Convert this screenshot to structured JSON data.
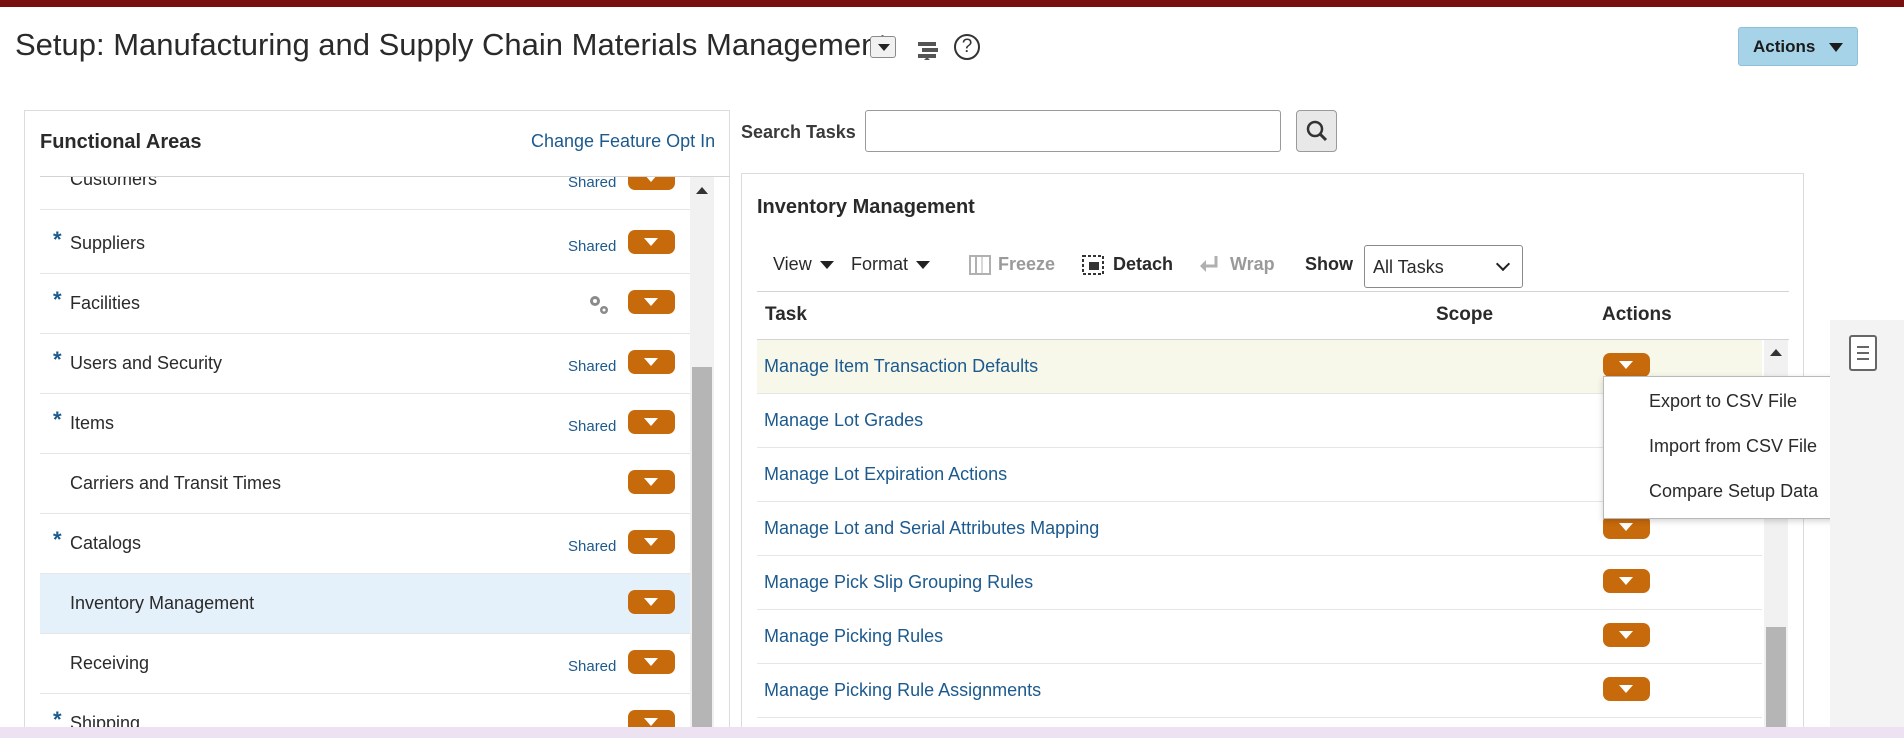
{
  "header": {
    "title": "Setup: Manufacturing and Supply Chain Materials Management",
    "help_glyph": "?",
    "actions_label": "Actions"
  },
  "functional_areas": {
    "title": "Functional Areas",
    "change_link": "Change Feature Opt In",
    "items": [
      {
        "label": "Customers",
        "required": false,
        "shared": "Shared",
        "selected": false
      },
      {
        "label": "Suppliers",
        "required": true,
        "shared": "Shared",
        "selected": false
      },
      {
        "label": "Facilities",
        "required": true,
        "shared": "",
        "gear_icon": true,
        "selected": false
      },
      {
        "label": "Users and Security",
        "required": true,
        "shared": "Shared",
        "selected": false
      },
      {
        "label": "Items",
        "required": true,
        "shared": "Shared",
        "selected": false
      },
      {
        "label": "Carriers and Transit Times",
        "required": false,
        "shared": "",
        "selected": false
      },
      {
        "label": "Catalogs",
        "required": true,
        "shared": "Shared",
        "selected": false
      },
      {
        "label": "Inventory Management",
        "required": false,
        "shared": "",
        "selected": true
      },
      {
        "label": "Receiving",
        "required": false,
        "shared": "Shared",
        "selected": false
      },
      {
        "label": "Shipping",
        "required": true,
        "shared": "",
        "selected": false
      }
    ],
    "required_marker": "*"
  },
  "search": {
    "label": "Search Tasks",
    "value": "",
    "placeholder": ""
  },
  "tasks_panel": {
    "title": "Inventory Management",
    "toolbar": {
      "view": "View",
      "format": "Format",
      "freeze": "Freeze",
      "detach": "Detach",
      "wrap": "Wrap",
      "show_label": "Show",
      "show_value": "All Tasks"
    },
    "columns": [
      "Task",
      "Scope",
      "Actions"
    ],
    "rows": [
      {
        "task": "Manage Item Transaction Defaults",
        "highlight": true
      },
      {
        "task": "Manage Lot Grades",
        "highlight": false
      },
      {
        "task": "Manage Lot Expiration Actions",
        "highlight": false
      },
      {
        "task": "Manage Lot and Serial Attributes Mapping",
        "highlight": false
      },
      {
        "task": "Manage Pick Slip Grouping Rules",
        "highlight": false
      },
      {
        "task": "Manage Picking Rules",
        "highlight": false
      },
      {
        "task": "Manage Picking Rule Assignments",
        "highlight": false
      }
    ]
  },
  "popup_menu": {
    "items": [
      "Export to CSV File",
      "Import from CSV File",
      "Compare Setup Data"
    ]
  },
  "colors": {
    "brand_bar": "#7a0f0f",
    "link": "#1c5a8e",
    "action_button": "#c76a0c",
    "actions_header_button": "#a7d3e8",
    "selected_row": "#e4f1fb"
  }
}
